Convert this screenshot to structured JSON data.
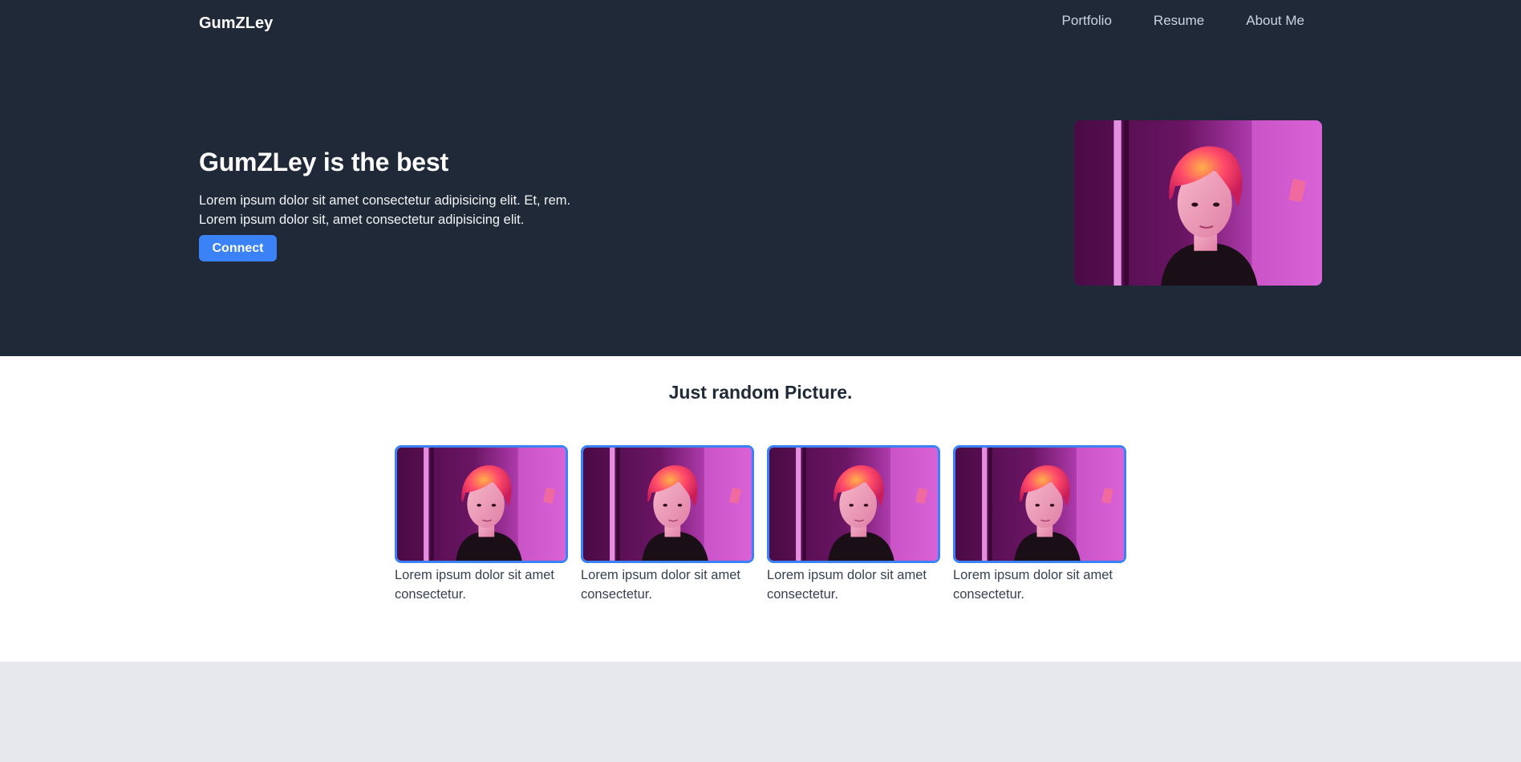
{
  "nav": {
    "brand": "GumZLey",
    "links": [
      "Portfolio",
      "Resume",
      "About Me"
    ]
  },
  "hero": {
    "title": "GumZLey is the best",
    "line1": "Lorem ipsum dolor sit amet consectetur adipisicing elit. Et, rem.",
    "line2": "Lorem ipsum dolor sit, amet consectetur adipisicing elit.",
    "button": "Connect"
  },
  "gallery": {
    "title": "Just random Picture.",
    "cards": [
      {
        "caption": "Lorem ipsum dolor sit amet consectetur."
      },
      {
        "caption": "Lorem ipsum dolor sit amet consectetur."
      },
      {
        "caption": "Lorem ipsum dolor sit amet consectetur."
      },
      {
        "caption": "Lorem ipsum dolor sit amet consectetur."
      }
    ]
  },
  "colors": {
    "hero_bg": "#1f2937",
    "accent": "#3b82f6",
    "footer_bg": "#e5e7eb"
  }
}
